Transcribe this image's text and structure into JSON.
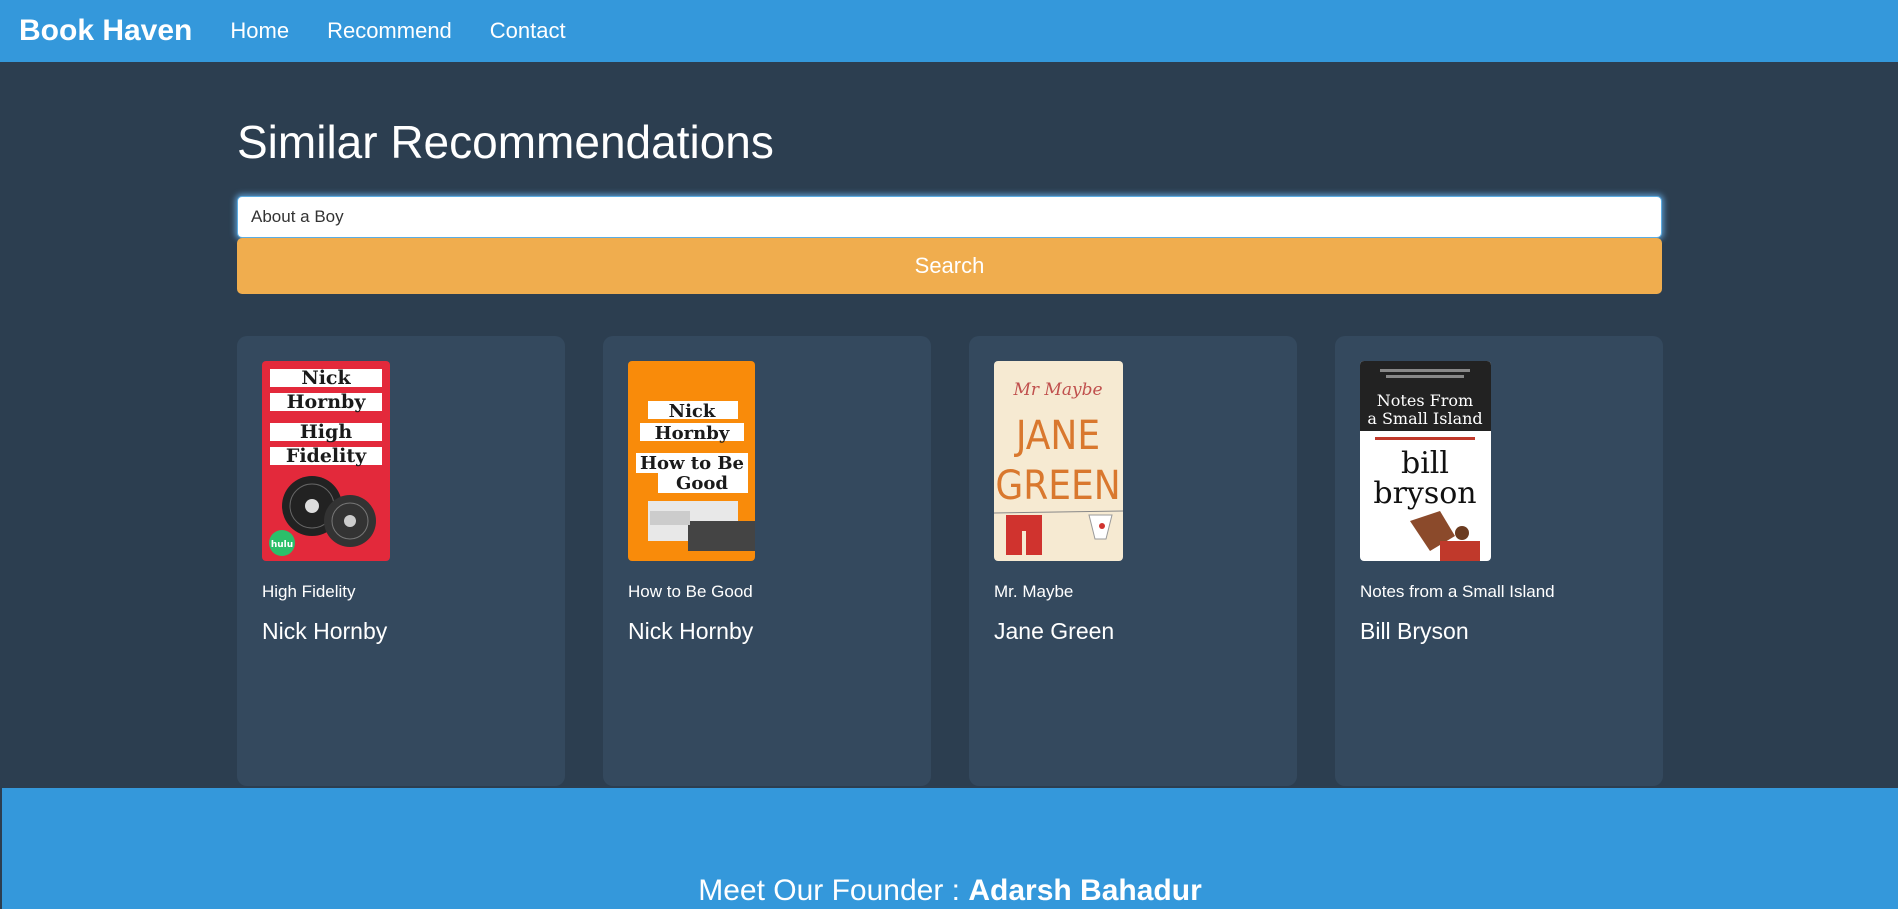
{
  "navbar": {
    "brand": "Book Haven",
    "links": [
      "Home",
      "Recommend",
      "Contact"
    ]
  },
  "main": {
    "title": "Similar Recommendations",
    "search": {
      "value": "About a Boy",
      "button_label": "Search"
    }
  },
  "results": [
    {
      "title": "High Fidelity",
      "author": "Nick Hornby",
      "cover": {
        "bg": "#e3293b",
        "text_lines": [
          "Nick",
          "Hornby",
          "High",
          "Fidelity"
        ],
        "badge": "hulu"
      }
    },
    {
      "title": "How to Be Good",
      "author": "Nick Hornby",
      "cover": {
        "bg": "#f98b0a",
        "text_lines": [
          "Nick",
          "Hornby",
          "How to Be",
          "Good"
        ]
      }
    },
    {
      "title": "Mr. Maybe",
      "author": "Jane Green",
      "cover": {
        "bg": "#f6ead2",
        "text_lines": [
          "Mr Maybe",
          "JANE",
          "GREEN"
        ]
      }
    },
    {
      "title": "Notes from a Small Island",
      "author": "Bill Bryson",
      "cover": {
        "bg": "#ffffff",
        "text_lines": [
          "Notes From",
          "a Small Island",
          "bill",
          "bryson"
        ]
      }
    }
  ],
  "footer": {
    "prefix": "Meet Our Founder : ",
    "name": "Adarsh Bahadur"
  },
  "colors": {
    "navbar": "#3498db",
    "background": "#2c3e50",
    "card": "#34495e",
    "button": "#f0ad4e"
  }
}
